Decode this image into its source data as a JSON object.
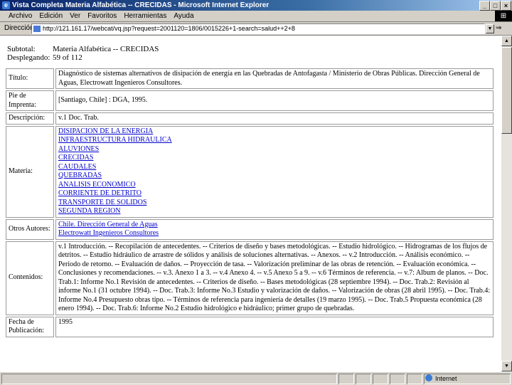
{
  "window": {
    "title": "Vista Completa Materia Alfabética -- CRECIDAS - Microsoft Internet Explorer",
    "controls": [
      "_",
      "□",
      "×"
    ]
  },
  "menu": [
    "Archivo",
    "Edición",
    "Ver",
    "Favoritos",
    "Herramientas",
    "Ayuda"
  ],
  "address": {
    "label": "Dirección",
    "url": "http://121.161.17/webcat/vq.jsp?request=2001120=1806/0015226+1-search=salud++2+8",
    "go": "⇒"
  },
  "page": {
    "sub_label": "Subtotal:",
    "sub_value": "Materia Alfabética -- CRECIDAS",
    "disp_label": "Desplegando:",
    "disp_value": "59 of 112"
  },
  "record": {
    "titulo": {
      "label": "Título:",
      "value": "Diagnóstico de sistemas alternativos de disipación de energía en las Quebradas de Antofagasta / Ministerio de Obras Públicas. Dirección General de Aguas, Electrowatt Ingenieros Consultores."
    },
    "pie": {
      "label": "Pie de Imprenta:",
      "value": "[Santiago, Chile] : DGA, 1995."
    },
    "descripcion": {
      "label": "Descripción:",
      "value": "v.1 Doc. Trab."
    },
    "materia": {
      "label": "Materia:",
      "items": [
        "DISIPACION DE LA ENERGIA",
        "INFRAESTRUCTURA HIDRAULICA",
        "ALUVIONES",
        "CRECIDAS",
        "CAUDALES",
        "QUEBRADAS",
        "ANALISIS ECONOMICO",
        "CORRIENTE DE DETRITO",
        "TRANSPORTE DE SOLIDOS",
        "SEGUNDA REGION"
      ]
    },
    "autores": {
      "label": "Otros Autores:",
      "items": [
        "Chile. Dirección General de Aguas",
        "Electrowatt Ingenieros Consultores"
      ]
    },
    "contenidos": {
      "label": "Contenidos:",
      "value": "v.1 Introducción. -- Recopilación de antecedentes. -- Criterios de diseño y bases metodológicas. -- Estudio hidrológico. -- Hidrogramas de los flujos de detritos. -- Estudio hidráulico de arrastre de sólidos y análisis de soluciones alternativas. -- Anexos. -- v.2 Introducción. -- Análisis económico. -- Periodo de retorno. -- Evaluación de daños. -- Proyección de tasa. -- Valorización preliminar de las obras de retención. -- Evaluación económica. -- Conclusiones y recomendaciones. -- v.3. Anexo 1 a 3. -- v.4 Anexo 4. -- v.5 Anexo 5 a 9. -- v.6 Términos de referencia. -- v.7: Album de planos. -- Doc. Trab.1: Informe No.1 Revisión de antecedentes. -- Criterios de diseño. -- Bases metodológicas (28 septiembre 1994). -- Doc. Trab.2: Revisión al informe No.1 (31 octubre 1994). -- Doc. Trab.3: Informe No.3 Estudio y valorización de daños. -- Valorización de obras (28 abril 1995). -- Doc. Trab.4: Informe No.4 Presupuesto obras tipo. -- Términos de referencia para ingeniería de detalles (19 marzo 1995). -- Doc. Trab.5 Propuesta económica (28 enero 1994). -- Doc. Trab.6: Informe No.2 Estudio hidrológico e hidráulico; primer grupo de quebradas."
    },
    "fecha": {
      "label": "Fecha de Publicación:",
      "value": "1995"
    }
  },
  "status": {
    "zone": "Internet"
  }
}
